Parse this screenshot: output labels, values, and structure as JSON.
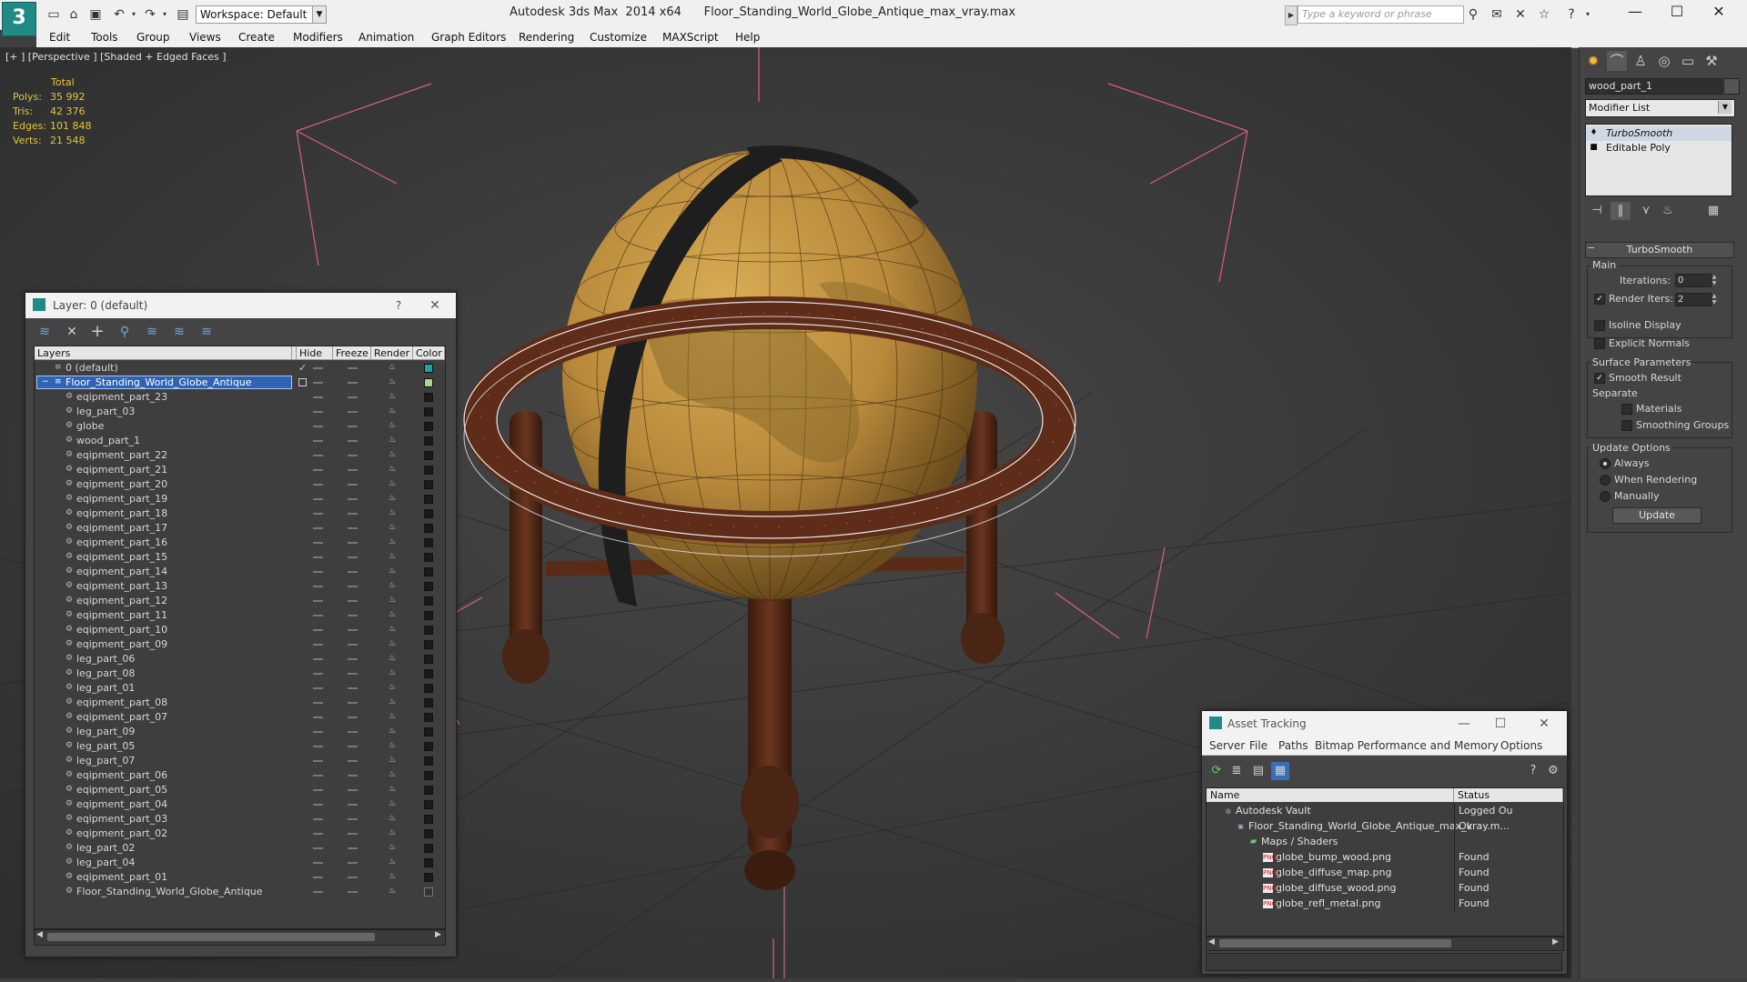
{
  "app": {
    "window_title": "Autodesk 3ds Max  2014 x64      Floor_Standing_World_Globe_Antique_max_vray.max",
    "workspace": "Workspace: Default",
    "search_placeholder": "Type a keyword or phrase",
    "accent_color": "#1f8a86"
  },
  "menubar": [
    "Edit",
    "Tools",
    "Group",
    "Views",
    "Create",
    "Modifiers",
    "Animation",
    "Graph Editors",
    "Rendering",
    "Customize",
    "MAXScript",
    "Help"
  ],
  "viewport": {
    "label": "[+ ] [Perspective ] [Shaded + Edged Faces ]",
    "stats": {
      "total_label": "Total",
      "rows": [
        {
          "label": "Polys:",
          "value": "35 992"
        },
        {
          "label": "Tris:",
          "value": "42 376"
        },
        {
          "label": "Edges:",
          "value": "101 848"
        },
        {
          "label": "Verts:",
          "value": "21 548"
        }
      ]
    }
  },
  "command_panel": {
    "object_name": "wood_part_1",
    "modifier_list": "Modifier List",
    "stack": [
      "TurboSmooth",
      "Editable Poly"
    ],
    "rollout_title": "TurboSmooth",
    "main_group": "Main",
    "iterations_label": "Iterations:",
    "iterations_value": "0",
    "render_iters_label": "Render Iters:",
    "render_iters_value": "2",
    "isoline_display": "Isoline Display",
    "explicit_normals": "Explicit Normals",
    "surface_group": "Surface Parameters",
    "smooth_result": "Smooth Result",
    "separate": "Separate",
    "materials": "Materials",
    "smoothing_groups": "Smoothing Groups",
    "update_group": "Update Options",
    "always": "Always",
    "when_rendering": "When Rendering",
    "manually": "Manually",
    "update_button": "Update"
  },
  "layer_window": {
    "title": "Layer: 0 (default)",
    "help": "?",
    "columns": [
      "Layers",
      "Hide",
      "Freeze",
      "Render",
      "Color"
    ],
    "default_layer": "0 (default)",
    "selected_layer": "Floor_Standing_World_Globe_Antique",
    "objects": [
      "eqipment_part_23",
      "leg_part_03",
      "globe",
      "wood_part_1",
      "eqipment_part_22",
      "eqipment_part_21",
      "eqipment_part_20",
      "eqipment_part_19",
      "eqipment_part_18",
      "eqipment_part_17",
      "eqipment_part_16",
      "eqipment_part_15",
      "eqipment_part_14",
      "eqipment_part_13",
      "eqipment_part_12",
      "eqipment_part_11",
      "eqipment_part_10",
      "eqipment_part_09",
      "leg_part_06",
      "leg_part_08",
      "leg_part_01",
      "eqipment_part_08",
      "eqipment_part_07",
      "leg_part_09",
      "leg_part_05",
      "leg_part_07",
      "eqipment_part_06",
      "eqipment_part_05",
      "eqipment_part_04",
      "eqipment_part_03",
      "eqipment_part_02",
      "leg_part_02",
      "leg_part_04",
      "eqipment_part_01",
      "Floor_Standing_World_Globe_Antique"
    ]
  },
  "asset_window": {
    "title": "Asset Tracking",
    "menu": [
      "Server",
      "File",
      "Paths",
      "Bitmap Performance and Memory",
      "Options"
    ],
    "columns": [
      "Name",
      "Status"
    ],
    "rows": [
      {
        "name": "Autodesk Vault",
        "status": "Logged Ou"
      },
      {
        "name": "Floor_Standing_World_Globe_Antique_max_vray.m...",
        "status": "Ok"
      },
      {
        "name": "Maps / Shaders",
        "status": ""
      },
      {
        "name": "globe_bump_wood.png",
        "status": "Found"
      },
      {
        "name": "globe_diffuse_map.png",
        "status": "Found"
      },
      {
        "name": "globe_diffuse_wood.png",
        "status": "Found"
      },
      {
        "name": "globe_refl_metal.png",
        "status": "Found"
      }
    ],
    "png_icon": "PNG"
  }
}
